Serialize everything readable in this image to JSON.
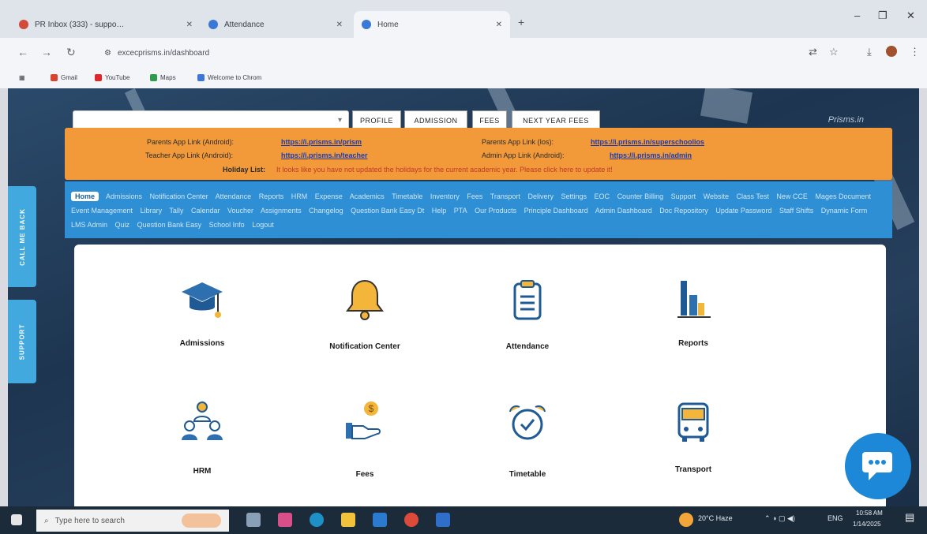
{
  "browser": {
    "tabs": [
      {
        "label": "PR Inbox (333) - suppo…",
        "fav": "#d24a3a"
      },
      {
        "label": "Attendance",
        "fav": "#3a78d8"
      },
      {
        "label": "Home",
        "fav": "#3a78d8"
      }
    ],
    "url": "excecprisms.in/dashboard",
    "bookmarks": [
      {
        "label": "Gmail",
        "color": "#d8452f"
      },
      {
        "label": "YouTube",
        "color": "#e0282a"
      },
      {
        "label": "Maps",
        "color": "#2e9c4f"
      },
      {
        "label": "Welcome to Chrom",
        "color": "#3a78d8"
      }
    ]
  },
  "header": {
    "buttons": [
      "PROFILE",
      "ADMISSION",
      "FEES",
      "NEXT YEAR FEES"
    ],
    "brand": "Prisms.in"
  },
  "links": {
    "parents_android_label": "Parents App Link (Android):",
    "parents_android_url": "https://i.prisms.in/prism",
    "teacher_android_label": "Teacher App Link (Android):",
    "teacher_android_url": "https://i.prisms.in/teacher",
    "parents_ios_label": "Parents App Link (Ios):",
    "parents_ios_url": "https://i.prisms.in/superschoolios",
    "admin_android_label": "Admin App Link (Android):",
    "admin_android_url": "https://i.prisms.in/admin",
    "holiday_label": "Holiday List:",
    "holiday_text": "It looks like you have not updated the holidays for the current academic year. Please click here to update it!"
  },
  "menu": [
    "Home",
    "Admissions",
    "Notification Center",
    "Attendance",
    "Reports",
    "HRM",
    "Expense",
    "Academics",
    "Timetable",
    "Inventory",
    "Fees",
    "Transport",
    "Delivery",
    "Settings",
    "EOC",
    "Counter Billing",
    "Support",
    "Website",
    "Class Test",
    "New CCE",
    "Mages Document",
    "Event Management",
    "Library",
    "Tally",
    "Calendar",
    "Voucher",
    "Assignments",
    "Changelog",
    "Question Bank Easy Dt",
    "Help",
    "PTA",
    "Our Products",
    "Principle Dashboard",
    "Admin Dashboard",
    "Doc Repository",
    "Update Password",
    "Staff Shifts",
    "Dynamic Form",
    "LMS Admin",
    "Quiz",
    "Question Bank Easy",
    "School Info",
    "Logout"
  ],
  "side": {
    "call": "CALL ME BACK",
    "support": "SUPPORT"
  },
  "modules": [
    {
      "label": "Admissions",
      "icon": "graduation-cap-icon"
    },
    {
      "label": "Notification Center",
      "icon": "bell-icon"
    },
    {
      "label": "Attendance",
      "icon": "clipboard-icon"
    },
    {
      "label": "Reports",
      "icon": "bar-chart-icon"
    },
    {
      "label": "HRM",
      "icon": "people-icon"
    },
    {
      "label": "Fees",
      "icon": "hand-dollar-icon"
    },
    {
      "label": "Timetable",
      "icon": "alarm-clock-icon"
    },
    {
      "label": "Transport",
      "icon": "bus-icon"
    }
  ],
  "taskbar": {
    "search_placeholder": "Type here to search",
    "weather": "20°C Haze",
    "lang": "ENG",
    "time": "10:58 AM",
    "date": "1/14/2025"
  },
  "colors": {
    "orange": "#f29a3a",
    "blue": "#2e8fd4",
    "accent": "#1e88d8"
  }
}
